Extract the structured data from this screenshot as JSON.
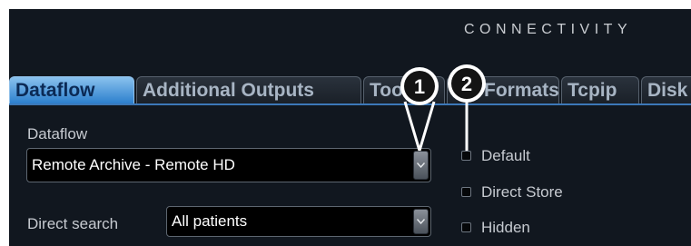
{
  "header": {
    "title": "CONNECTIVITY"
  },
  "tabs": [
    {
      "label": "Dataflow",
      "active": true
    },
    {
      "label": "Additional Outputs",
      "active": false
    },
    {
      "label": "Tools",
      "active": false
    },
    {
      "label": "Formats",
      "active": false
    },
    {
      "label": "Tcpip",
      "active": false
    },
    {
      "label": "Disk",
      "active": false
    }
  ],
  "dataflow": {
    "label": "Dataflow",
    "selected": "Remote Archive - Remote HD"
  },
  "direct_search": {
    "label": "Direct search",
    "selected": "All patients"
  },
  "checkboxes": [
    {
      "label": "Default",
      "checked": false
    },
    {
      "label": "Direct Store",
      "checked": false
    },
    {
      "label": "Hidden",
      "checked": false
    }
  ],
  "callouts": [
    "1",
    "2"
  ],
  "colors": {
    "panel_bg": "#11171f",
    "active_tab": "#2c7fcd",
    "active_tab_text": "#0b2a55",
    "inactive_tab_text": "#a8b5c4",
    "text": "#c6cad0"
  }
}
